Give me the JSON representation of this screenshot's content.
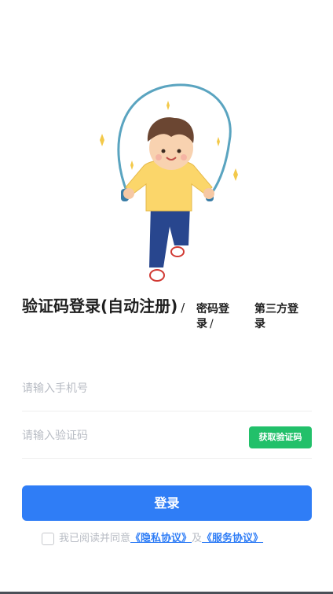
{
  "illustration": {
    "name": "jump-rope-boy-illustration"
  },
  "tabs": {
    "sms_login": "验证码登录(自动注册)",
    "password_login": "密码登录",
    "third_party_login": "第三方登录",
    "separator": "/"
  },
  "phone": {
    "placeholder": "请输入手机号"
  },
  "code": {
    "placeholder": "请输入验证码",
    "get_code_label": "获取验证码"
  },
  "login_button": "登录",
  "agreement": {
    "prefix": "我已阅读并同意",
    "privacy_link": "《隐私协议》",
    "conjunction": "及",
    "service_link": "《服务协议》"
  },
  "colors": {
    "primary": "#2f7df6",
    "code_button": "#22c06a",
    "placeholder": "#b8bcc4"
  }
}
